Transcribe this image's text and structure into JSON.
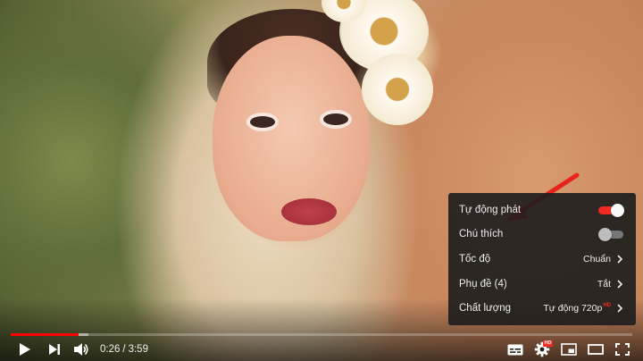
{
  "settings_menu": {
    "items": [
      {
        "label": "Tự động phát",
        "type": "toggle",
        "on": true
      },
      {
        "label": "Chú thích",
        "type": "toggle",
        "on": false
      },
      {
        "label": "Tốc độ",
        "value": "Chuẩn"
      },
      {
        "label": "Phụ đề (4)",
        "value": "Tắt"
      },
      {
        "label": "Chất lượng",
        "value": "Tự động 720p",
        "badge": "HD"
      }
    ]
  },
  "player": {
    "current_time": "0:26",
    "separator": "/",
    "duration": "3:59",
    "played_fraction": 0.109,
    "loaded_fraction": 0.125,
    "settings_badge": "HD"
  },
  "colors": {
    "accent_red": "#ff0000",
    "toggle_on": "#f12b24",
    "annotation_arrow": "#e8231b"
  },
  "icons": {
    "play": "play-icon",
    "next": "next-icon",
    "volume": "volume-icon",
    "subtitles": "subtitles-icon",
    "settings": "gear-icon",
    "miniplayer": "miniplayer-icon",
    "theater": "theater-mode-icon",
    "fullscreen": "fullscreen-icon"
  }
}
